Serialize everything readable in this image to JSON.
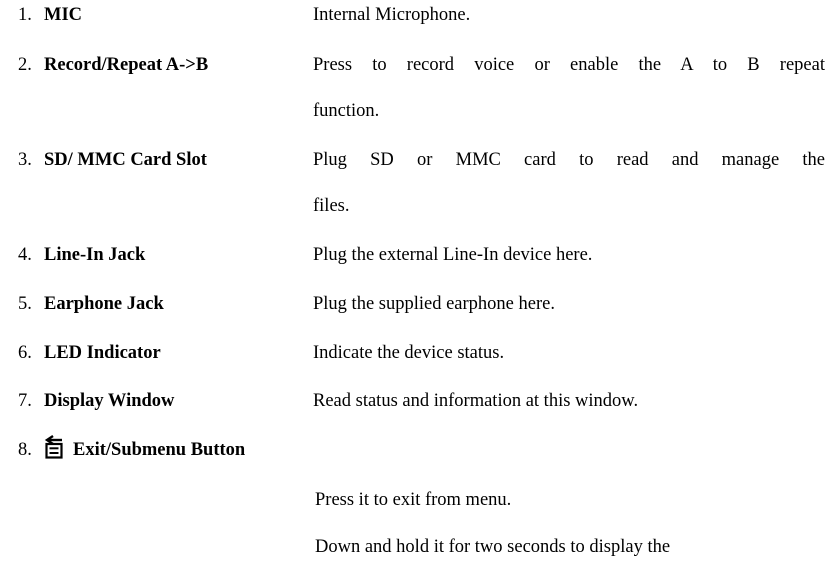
{
  "items": [
    {
      "num": "1.",
      "term": "MIC",
      "desc": [
        "Internal Microphone."
      ]
    },
    {
      "num": "2.",
      "term": "Record/Repeat A->B",
      "desc": [
        "Press to record voice or enable the A to B repeat",
        "function."
      ]
    },
    {
      "num": "3.",
      "term": "SD/ MMC Card Slot",
      "desc": [
        "Plug SD or MMC card to read and manage the",
        "files."
      ]
    },
    {
      "num": "4.",
      "term": "Line-In Jack",
      "desc": [
        "Plug the external Line-In device here."
      ]
    },
    {
      "num": "5.",
      "term": "Earphone Jack",
      "desc": [
        "Plug the supplied earphone here."
      ]
    },
    {
      "num": "6.",
      "term": "LED Indicator",
      "desc": [
        "Indicate the device status."
      ]
    },
    {
      "num": "7.",
      "term": "Display Window",
      "desc": [
        "Read status and information at this window."
      ]
    },
    {
      "num": "8.",
      "term": "Exit/Submenu Button",
      "icon": "exit-submenu-icon",
      "desc": [
        "Press it to exit from menu.",
        "Down and hold it for two seconds to display the"
      ]
    }
  ]
}
